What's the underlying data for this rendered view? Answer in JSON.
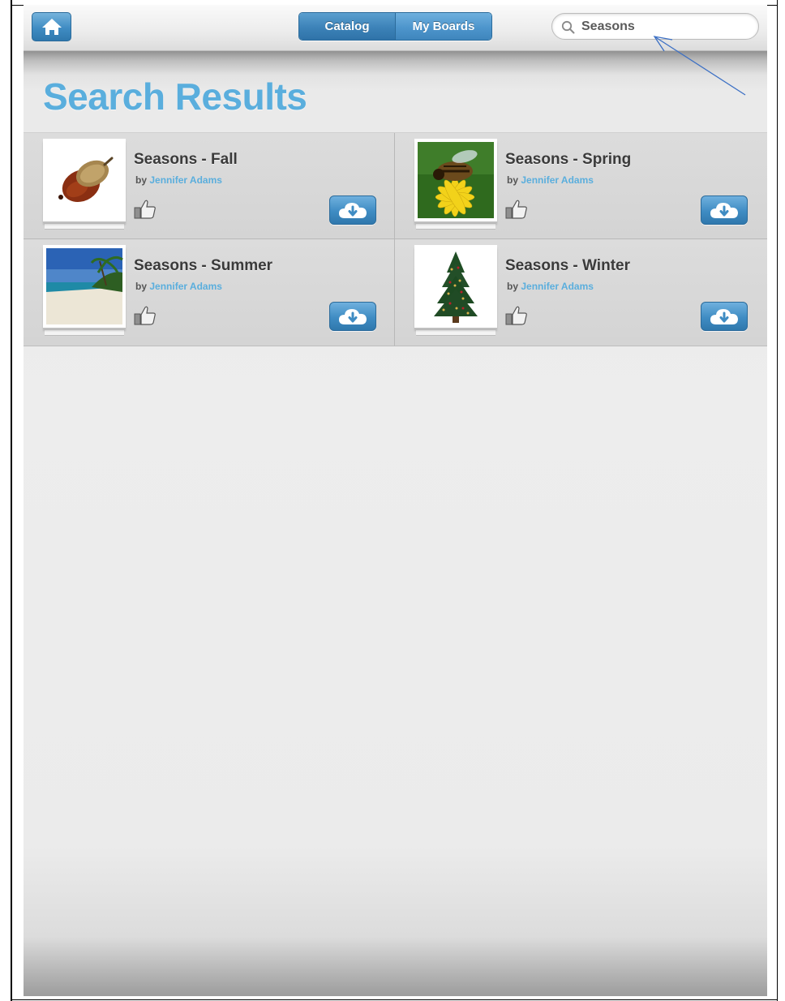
{
  "nav": {
    "home_icon": "home-icon",
    "tabs": [
      {
        "label": "Catalog",
        "active": true
      },
      {
        "label": "My Boards",
        "active": false
      }
    ],
    "search": {
      "value": "Seasons",
      "icon": "search-icon"
    }
  },
  "page": {
    "title": "Search Results"
  },
  "results": [
    {
      "title": "Seasons - Fall",
      "by": "by",
      "author": "Jennifer Adams",
      "image": "acorn"
    },
    {
      "title": "Seasons - Spring",
      "by": "by",
      "author": "Jennifer Adams",
      "image": "bee-on-flower"
    },
    {
      "title": "Seasons - Summer",
      "by": "by",
      "author": "Jennifer Adams",
      "image": "beach"
    },
    {
      "title": "Seasons - Winter",
      "by": "by",
      "author": "Jennifer Adams",
      "image": "christmas-tree"
    }
  ],
  "colors": {
    "accent": "#5aaedd",
    "button_blue": "#3f8cc3",
    "annotation_arrow": "#3b6fc4"
  }
}
